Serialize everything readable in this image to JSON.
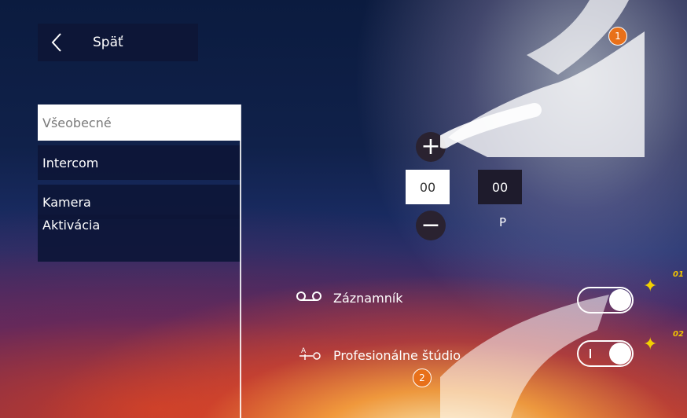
{
  "header": {
    "back_label": "Späť"
  },
  "menu": {
    "items": [
      {
        "label": "Všeobecné",
        "active": true
      },
      {
        "label": "Intercom",
        "active": false
      },
      {
        "label": "Kamera",
        "active": false
      },
      {
        "label": "Aktivácia",
        "active": false
      }
    ]
  },
  "time_setting": {
    "plus_label": "+",
    "minus_label": "−",
    "hours": "00",
    "minutes": "00",
    "unit_label": "P"
  },
  "options": {
    "voicemail": {
      "icon": "voicemail-icon",
      "label": "Záznamník",
      "enabled": true
    },
    "studio": {
      "icon": "studio-icon",
      "label": "Profesionálne štúdio",
      "enabled": true
    }
  },
  "callouts": {
    "step1": "1",
    "step2": "2",
    "badge1": "01",
    "badge2": "02"
  },
  "colors": {
    "panel": "#0d1637",
    "step": "#e8701a",
    "badge": "#f2c300"
  }
}
